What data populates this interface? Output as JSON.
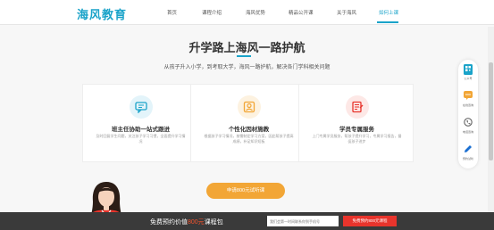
{
  "brand": {
    "logo_text": "海风教育",
    "accent": "#1aa3c9"
  },
  "nav": {
    "items": [
      {
        "label": "首页",
        "active": false
      },
      {
        "label": "课程介绍",
        "active": false
      },
      {
        "label": "海风优势",
        "active": false
      },
      {
        "label": "精品公开课",
        "active": false
      },
      {
        "label": "关于海风",
        "active": false
      },
      {
        "label": "如何上课",
        "active": true
      }
    ]
  },
  "hero": {
    "title": "升学路上海风一路护航",
    "subtitle": "从孩子升入小学，到考取大学，海风一路护航，解决各门学科相关问题"
  },
  "cards": [
    {
      "icon": "chat-service-icon",
      "icon_color": "#1aa3c9",
      "icon_bg": "#e3f4fa",
      "title": "班主任协助一站式跟进",
      "desc": "及时回复学生问题，关注孩子学习习惯，全面提升学习情况"
    },
    {
      "icon": "user-profile-icon",
      "icon_color": "#f2a636",
      "icon_bg": "#fdf2e0",
      "title": "个性化因材施教",
      "desc": "根据孩子学习情况，按需制定学习方案，因此帮孩子提高成绩，补足知识短板"
    },
    {
      "icon": "document-edit-icon",
      "icon_color": "#e8342c",
      "icon_bg": "#fde8e6",
      "title": "学员专属服务",
      "desc": "上门专属学员服务，帮孩子提升学习，专属学习报告，督促孩子进步"
    }
  ],
  "cta": {
    "label": "申请800元试听课"
  },
  "bottom_bar": {
    "text_prefix": "免费预约价值",
    "text_highlight": "800元",
    "text_suffix": "课程包",
    "phone_placeholder": "我们会第一时间联系你到手机号",
    "submit_label": "免费预约800元课程"
  },
  "float_panel": [
    {
      "icon": "qr-code-icon",
      "label": "公众号"
    },
    {
      "icon": "online-consult-icon",
      "label": "在线咨询"
    },
    {
      "icon": "phone-icon",
      "label": "电话咨询"
    },
    {
      "icon": "pencil-icon",
      "label": "预约试听"
    }
  ]
}
